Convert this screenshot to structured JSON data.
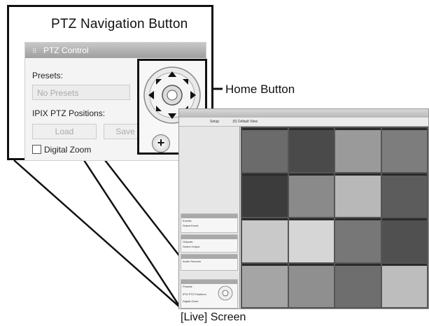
{
  "callout": {
    "title": "PTZ Navigation Button",
    "home_label": "Home Button",
    "panel": {
      "title": "PTZ Control",
      "presets_label": "Presets:",
      "presets_value": "No Presets",
      "ipix_label": "IPIX PTZ Positions:",
      "load_label": "Load",
      "save_label": "Save",
      "digital_zoom_label": "Digital Zoom",
      "zoom_in": "+",
      "zoom_out": "-"
    }
  },
  "screen": {
    "toolbar_setup": "Setup",
    "toolbar_view": "(5) Default View",
    "sidebar": {
      "events_label": "Events:",
      "events_value": "Select Event",
      "outputs_label": "Outputs:",
      "outputs_value": "Select Output",
      "audio_label": "Audio Sources",
      "presets_label": "Presets",
      "ipix_label": "IPIX PTZ Positions",
      "digital_zoom_label": "Digital Zoom"
    }
  },
  "caption": "[Live] Screen",
  "colors": {
    "line": "#111111",
    "panel_header": "#a8a8a8",
    "sidebar_header": "#a9a9a9",
    "tiles": [
      "#6b6b6b",
      "#4a4a4a",
      "#9a9a9a",
      "#7d7d7d",
      "#3c3c3c",
      "#8a8a8a",
      "#b8b8b8",
      "#5c5c5c",
      "#c9c9c9",
      "#d6d6d6",
      "#777777",
      "#505050",
      "#a5a5a5",
      "#8f8f8f",
      "#6e6e6e",
      "#bdbdbd"
    ]
  }
}
